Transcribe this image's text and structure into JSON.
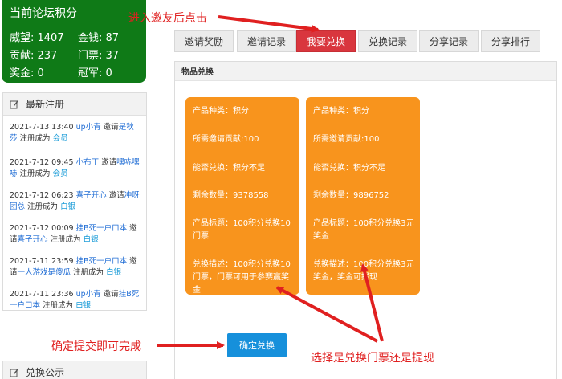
{
  "stats": {
    "title": "当前论坛积分",
    "prestige": "威望: 1407",
    "money": "金钱: 87",
    "contribution": "贡献: 237",
    "tickets": "门票: 37",
    "bonus": "奖金: 0",
    "champion": "冠军: 0"
  },
  "registrations": {
    "title": "最新注册",
    "items": [
      {
        "time": "2021-7-13 13:40",
        "inviter": "up小青",
        "mid": " 邀请",
        "invitee": "是秋莎",
        "tail": " 注册成为 ",
        "group": "会员"
      },
      {
        "time": "2021-7-12 09:45",
        "inviter": "小布丁",
        "mid": " 邀请",
        "invitee": "嘿哧嘿哧",
        "tail": " 注册成为 ",
        "group": "会员"
      },
      {
        "time": "2021-7-12 06:23",
        "inviter": "喜子开心",
        "mid": " 邀请",
        "invitee": "冲呀团总",
        "tail": " 注册成为 ",
        "group": "白银"
      },
      {
        "time": "2021-7-12 00:09",
        "inviter": "挂B死一户口本",
        "mid": " 邀请",
        "invitee": "喜子开心",
        "tail": " 注册成为 ",
        "group": "白银"
      },
      {
        "time": "2021-7-11 23:59",
        "inviter": "挂B死一户口本",
        "mid": " 邀请",
        "invitee": "一人游戏是傻瓜",
        "tail": " 注册成为 ",
        "group": "白银"
      },
      {
        "time": "2021-7-11 23:36",
        "inviter": "up小青",
        "mid": " 邀请",
        "invitee": "挂B死一户口本",
        "tail": " 注册成为 ",
        "group": "白银"
      }
    ]
  },
  "exchange_notice": {
    "title": "兑换公示"
  },
  "tabs": [
    "邀请奖励",
    "邀请记录",
    "我要兑换",
    "兑换记录",
    "分享记录",
    "分享排行"
  ],
  "main": {
    "title": "物品兑换",
    "cards": [
      {
        "category": "产品种类：积分",
        "required": "所需邀请贡献:100",
        "can_exchange": "能否兑换：积分不足",
        "remaining": "剩余数量：9378558",
        "name": "产品标题：100积分兑换10门票",
        "desc": "兑换描述：100积分兑换10门票，门票可用于参赛赢奖金"
      },
      {
        "category": "产品种类：积分",
        "required": "所需邀请贡献:100",
        "can_exchange": "能否兑换：积分不足",
        "remaining": "剩余数量：9896752",
        "name": "产品标题：100积分兑换3元奖金",
        "desc": "兑换描述：100积分兑换3元奖金，奖金可提现"
      }
    ],
    "confirm_label": "确定兑换"
  },
  "annotations": {
    "top": "进入邀友后点击",
    "left": "确定提交即可完成",
    "bottom": "选择是兑换门票还是提现"
  },
  "colors": {
    "stats_bg": "#0f7a17",
    "tab_active": "#d9363e",
    "card": "#f8941d",
    "button": "#1690db",
    "annotation": "#e02020"
  }
}
